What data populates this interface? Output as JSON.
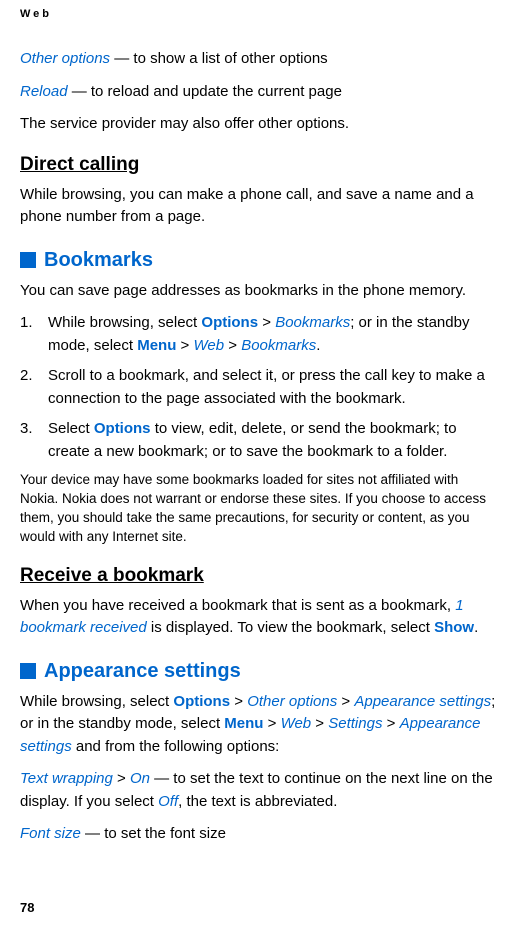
{
  "header": "Web",
  "intro": {
    "other_options_label": "Other options",
    "other_options_desc": " — to show a list of other options",
    "reload_label": "Reload",
    "reload_desc": " — to reload and update the current page",
    "provider_note": "The service provider may also offer other options."
  },
  "direct_calling": {
    "heading": "Direct calling",
    "text": "While browsing, you can make a phone call, and save a name and a phone number from a page."
  },
  "bookmarks": {
    "heading": "Bookmarks",
    "intro": "You can save page addresses as bookmarks in the phone memory.",
    "step1_pre": "While browsing, select ",
    "options": "Options",
    "gt1": " > ",
    "bookmarks_i": "Bookmarks",
    "step1_mid": "; or in the standby mode, select ",
    "menu": "Menu",
    "web_i": "Web",
    "step1_end": ".",
    "step2": "Scroll to a bookmark, and select it, or press the call key to make a connection to the page associated with the bookmark.",
    "step3_pre": "Select ",
    "step3_post": " to view, edit, delete, or send the bookmark; to create a new bookmark; or to save the bookmark to a folder.",
    "disclaimer": "Your device may have some bookmarks loaded for sites not affiliated with Nokia. Nokia does not warrant or endorse these sites. If you choose to access them, you should take the same precautions, for security or content, as you would with any Internet site."
  },
  "receive": {
    "heading": "Receive a bookmark",
    "pre": "When you have received a bookmark that is sent as a bookmark, ",
    "ital": "1 bookmark received",
    "mid": " is displayed. To view the bookmark, select ",
    "show": "Show",
    "end": "."
  },
  "appearance": {
    "heading": "Appearance settings",
    "p1_pre": "While browsing, select ",
    "options": "Options",
    "gt": " > ",
    "other_opts": "Other options",
    "app_set": "Appearance settings",
    "p1_mid": "; or in the standby mode, select ",
    "menu": "Menu",
    "web": "Web",
    "settings": "Settings",
    "p1_end": " and from the following options:",
    "tw_label": "Text wrapping",
    "on": "On",
    "tw_desc": " — to set the text to continue on the next line on the display. If you select ",
    "off": "Off",
    "tw_end": ", the text is abbreviated.",
    "fs_label": "Font size",
    "fs_desc": " — to set the font size"
  },
  "page": "78"
}
